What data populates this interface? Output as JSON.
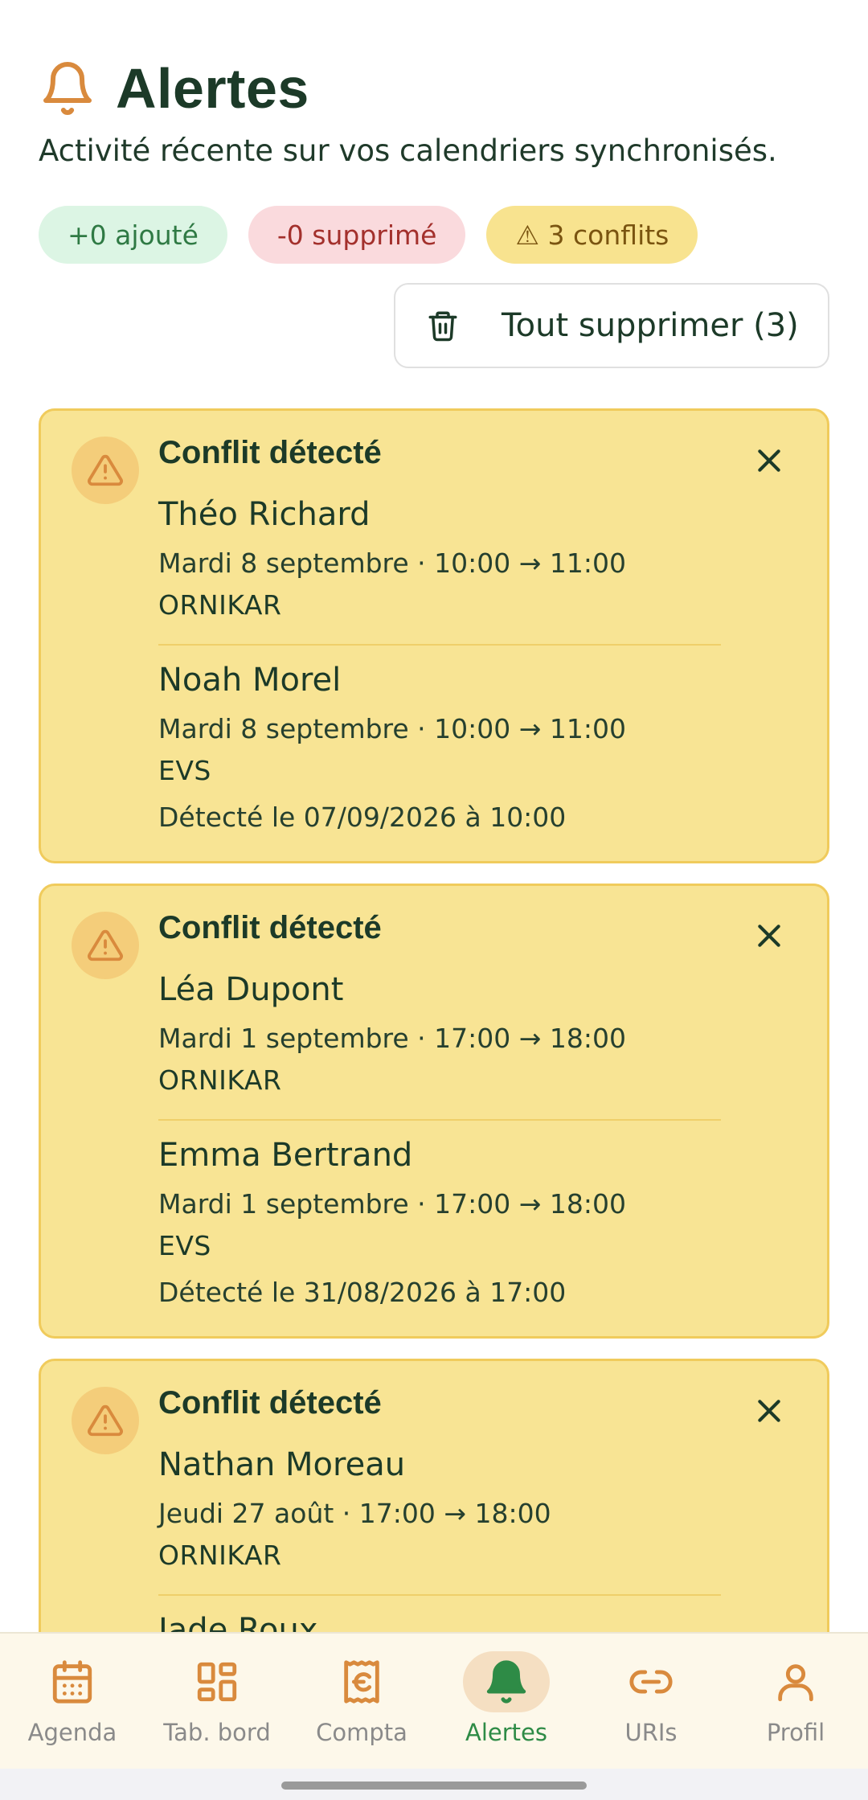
{
  "header": {
    "title": "Alertes",
    "subtitle": "Activité récente sur vos calendriers synchronisés.",
    "icon": "bell-icon"
  },
  "summary": {
    "added": "+0 ajouté",
    "removed": "-0 supprimé",
    "conflicts": "⚠ 3 conflits"
  },
  "actions": {
    "clear_all": "Tout supprimer (3)"
  },
  "alerts": [
    {
      "heading": "Conflit détecté",
      "events": [
        {
          "name": "Théo Richard",
          "time": "Mardi 8 septembre · 10:00 → 11:00",
          "source": "ORNIKAR"
        },
        {
          "name": "Noah Morel",
          "time": "Mardi 8 septembre · 10:00 → 11:00",
          "source": "EVS"
        }
      ],
      "detected": "Détecté le 07/09/2026 à 10:00"
    },
    {
      "heading": "Conflit détecté",
      "events": [
        {
          "name": "Léa Dupont",
          "time": "Mardi 1 septembre · 17:00 → 18:00",
          "source": "ORNIKAR"
        },
        {
          "name": "Emma Bertrand",
          "time": "Mardi 1 septembre · 17:00 → 18:00",
          "source": "EVS"
        }
      ],
      "detected": "Détecté le 31/08/2026 à 17:00"
    },
    {
      "heading": "Conflit détecté",
      "events": [
        {
          "name": "Nathan Moreau",
          "time": "Jeudi 27 août · 17:00 → 18:00",
          "source": "ORNIKAR"
        },
        {
          "name": "Jade Roux",
          "time": "",
          "source": ""
        }
      ],
      "detected": ""
    }
  ],
  "nav": {
    "items": [
      {
        "label": "Agenda",
        "icon": "calendar-icon"
      },
      {
        "label": "Tab. bord",
        "icon": "dashboard-icon"
      },
      {
        "label": "Compta",
        "icon": "receipt-euro-icon"
      },
      {
        "label": "Alertes",
        "icon": "bell-icon",
        "active": true
      },
      {
        "label": "URIs",
        "icon": "link-icon"
      },
      {
        "label": "Profil",
        "icon": "user-icon"
      }
    ]
  },
  "colors": {
    "accent": "#d98a3d",
    "active": "#2e8b46",
    "card_bg": "#f8e494",
    "card_border": "#f0cb5c"
  }
}
